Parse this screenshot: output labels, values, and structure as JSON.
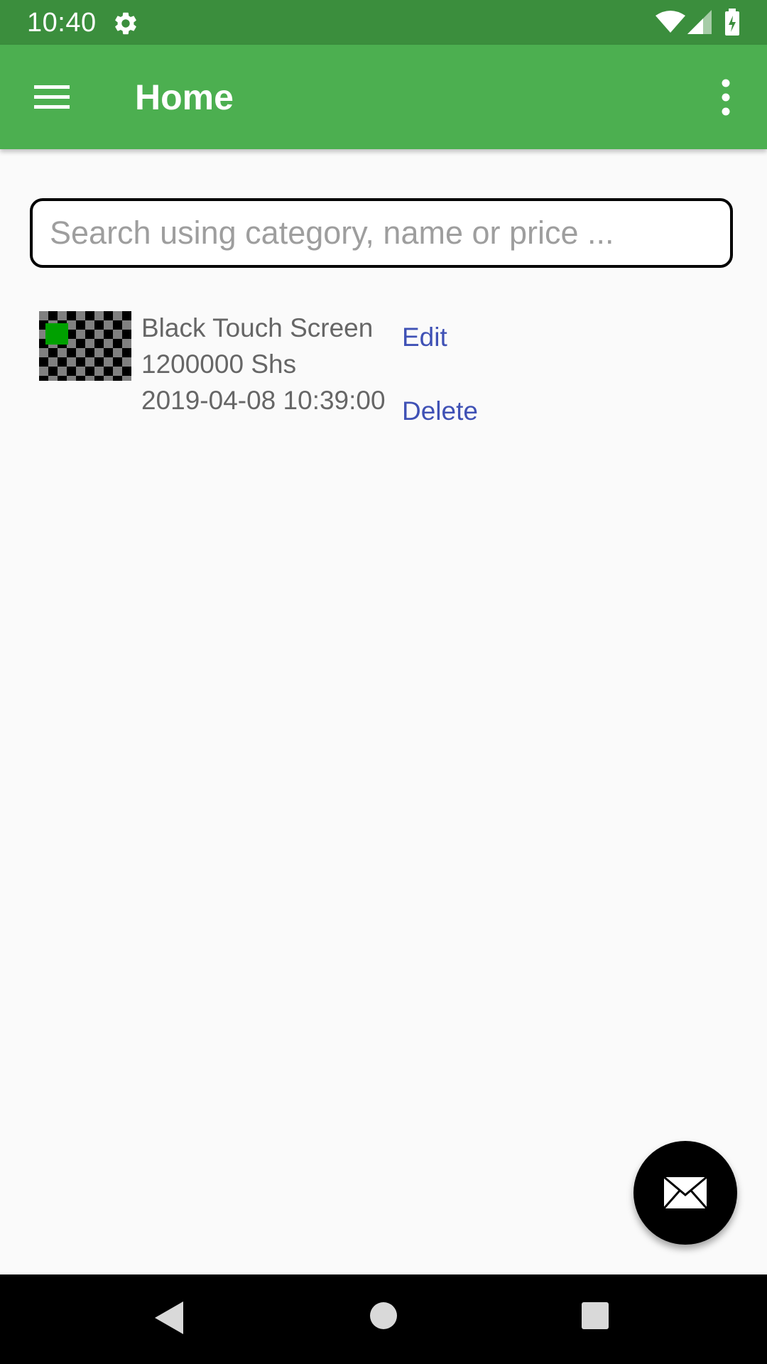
{
  "status_bar": {
    "time": "10:40",
    "icons": [
      "gear-icon",
      "wifi-icon",
      "signal-icon",
      "battery-icon"
    ]
  },
  "app_bar": {
    "title": "Home",
    "menu_icon": "menu-icon",
    "overflow_icon": "more-vert-icon",
    "color": "#4caf50",
    "status_color": "#3b8e3d"
  },
  "search": {
    "placeholder": "Search using category, name or price ...",
    "value": ""
  },
  "items": [
    {
      "name": "Black Touch Screen",
      "price": "1200000 Shs",
      "date": "2019-04-08 10:39:00",
      "edit_label": "Edit",
      "delete_label": "Delete"
    }
  ],
  "fab": {
    "icon": "mail-icon"
  },
  "nav_bar": {
    "icons": [
      "back-icon",
      "home-icon",
      "recents-icon"
    ]
  },
  "colors": {
    "link": "#3f51b5",
    "text_secondary": "#666666"
  }
}
